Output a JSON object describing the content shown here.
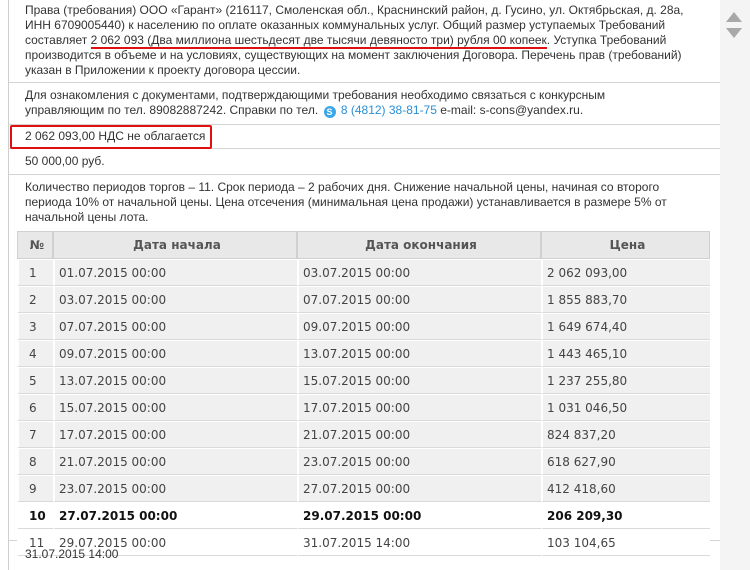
{
  "rights_text": {
    "part1": "Права (требования) ООО «Гарант» (216117, Смоленская обл., Краснинский район, д. Гусино, ул. Октябрьская, д. 28а, ИНН 6709005440) к населению по оплате оказанных коммунальных услуг. Общий размер уступаемых Требований составляет ",
    "amount": "2 062 093 (Два миллиона шестьдесят две тысячи девяносто три) рубля 00 копеек",
    "part2": ". Уступка Требований производится в объеме и на условиях, существующих на момент заключения Договора. Перечень прав (требований) указан в Приложении к проекту договора цессии."
  },
  "contact_text": {
    "part1": "Для ознакомления с документами, подтверждающими требования необходимо связаться с конкурсным управляющим по тел. 89082887242. Справки по тел.",
    "skype": "S",
    "phone": "8 (4812) 38-81-75",
    "part2": " e-mail: s-cons@yandex.ru."
  },
  "start_price": "2 062 093,00 НДС не облагается",
  "deposit": "50 000,00 руб.",
  "periods_text": "Количество периодов торгов – 11. Срок периода – 2 рабочих дня. Снижение начальной цены, начиная со второго периода 10% от начальной цены. Цена отсечения (минимальная цена продажи) устанавливается в размере 5% от начальной цены лота.",
  "table": {
    "headers": [
      "№",
      "Дата начала",
      "Дата окончания",
      "Цена"
    ],
    "rows": [
      [
        "1",
        "01.07.2015 00:00",
        "03.07.2015 00:00",
        "2 062 093,00"
      ],
      [
        "2",
        "03.07.2015 00:00",
        "07.07.2015 00:00",
        "1 855 883,70"
      ],
      [
        "3",
        "07.07.2015 00:00",
        "09.07.2015 00:00",
        "1 649 674,40"
      ],
      [
        "4",
        "09.07.2015 00:00",
        "13.07.2015 00:00",
        "1 443 465,10"
      ],
      [
        "5",
        "13.07.2015 00:00",
        "15.07.2015 00:00",
        "1 237 255,80"
      ],
      [
        "6",
        "15.07.2015 00:00",
        "17.07.2015 00:00",
        "1 031 046,50"
      ],
      [
        "7",
        "17.07.2015 00:00",
        "21.07.2015 00:00",
        "824 837,20"
      ],
      [
        "8",
        "21.07.2015 00:00",
        "23.07.2015 00:00",
        "618 627,90"
      ],
      [
        "9",
        "23.07.2015 00:00",
        "27.07.2015 00:00",
        "412 418,60"
      ],
      [
        "10",
        "27.07.2015 00:00",
        "29.07.2015 00:00",
        "206 209,30"
      ],
      [
        "11",
        "29.07.2015 00:00",
        "31.07.2015 14:00",
        "103 104,65"
      ]
    ]
  },
  "end_date": "31.07.2015 14:00",
  "colors": {
    "highlight": "#e01010",
    "link": "#2a8fd6"
  }
}
